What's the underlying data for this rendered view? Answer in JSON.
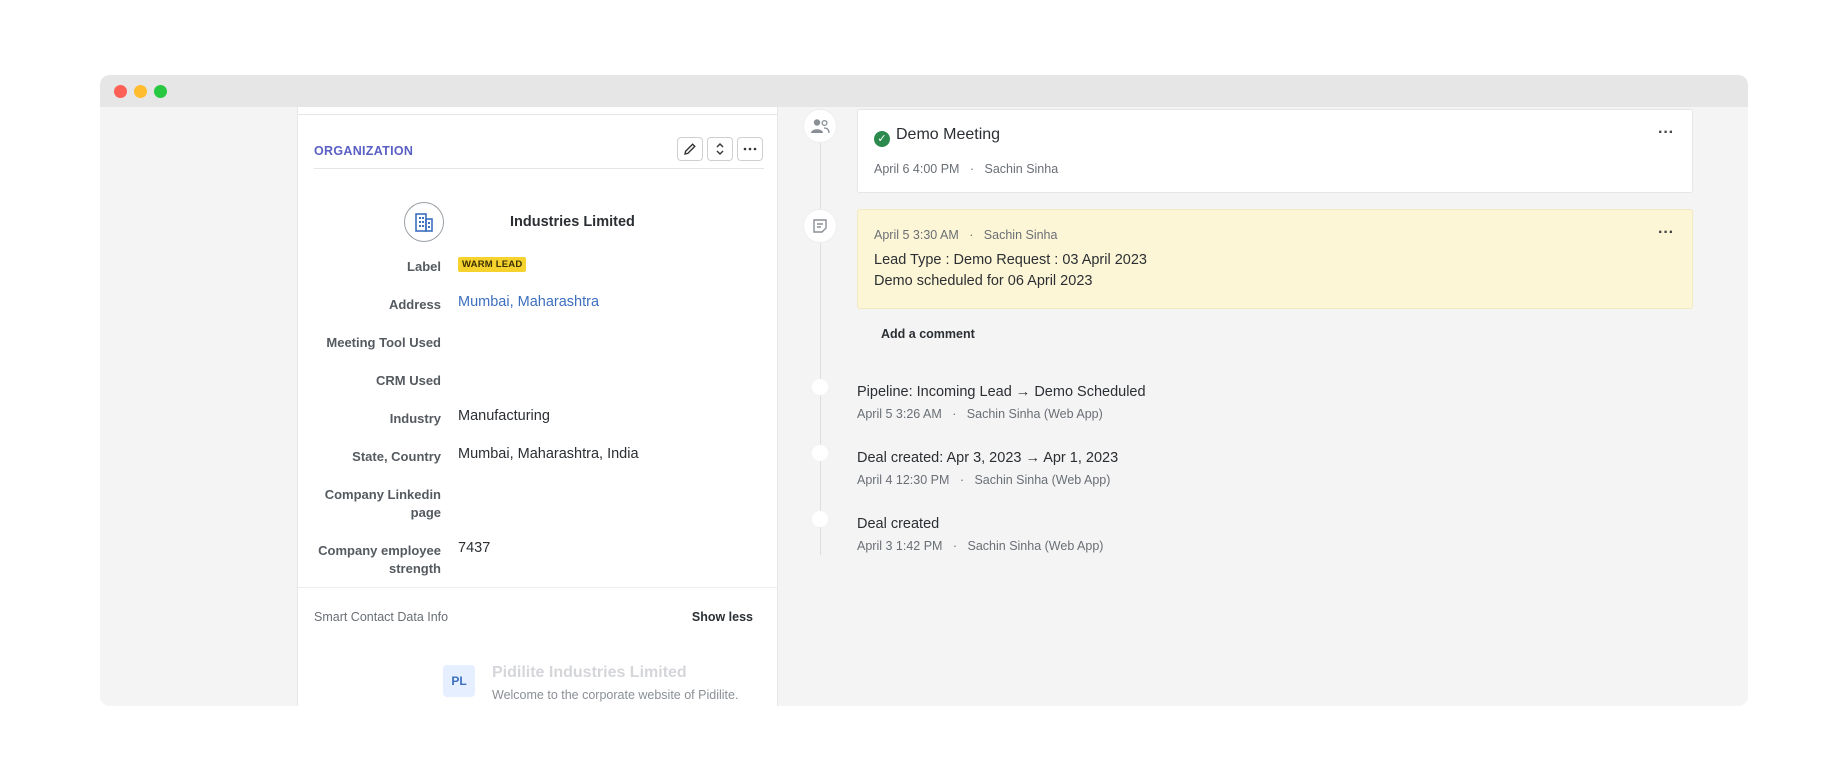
{
  "window": {
    "controls": [
      "close",
      "minimize",
      "maximize"
    ]
  },
  "organization": {
    "section_title": "ORGANIZATION",
    "actions": [
      "edit-icon",
      "expand-collapse-icon",
      "more-icon"
    ],
    "name": "Industries Limited",
    "fields": [
      {
        "label": "Label",
        "value": "WARM LEAD",
        "type": "badge"
      },
      {
        "label": "Address",
        "value": "Mumbai, Maharashtra",
        "type": "link"
      },
      {
        "label": "Meeting Tool Used",
        "value": ""
      },
      {
        "label": "CRM Used",
        "value": ""
      },
      {
        "label": "Industry",
        "value": "Manufacturing"
      },
      {
        "label": "State, Country",
        "value": "Mumbai, Maharashtra, India"
      },
      {
        "label": "Company Linkedin page",
        "value": ""
      },
      {
        "label": "Company employee strength",
        "value": "7437"
      }
    ],
    "smart_data_label": "Smart Contact Data Info",
    "show_less_label": "Show less",
    "suggestion": {
      "avatar": "PL",
      "name": "Pidilite Industries Limited",
      "description": "Welcome to the corporate website of Pidilite."
    }
  },
  "timeline": {
    "meeting": {
      "title": "Demo Meeting",
      "meta": "April 6 4:00 PM",
      "author": "Sachin Sinha"
    },
    "note": {
      "meta": "April 5 3:30 AM",
      "author": "Sachin Sinha",
      "line1": "Lead Type : Demo Request : 03 April 2023",
      "line2": "Demo scheduled for 06 April 2023"
    },
    "add_comment_label": "Add a comment",
    "events": [
      {
        "title": "Pipeline: Incoming Lead → Demo Scheduled",
        "time": "April 5 3:26 AM",
        "author": "Sachin Sinha (Web App)"
      },
      {
        "title": "Deal created: Apr 3, 2023 → Apr 1, 2023",
        "time": "April 4 12:30 PM",
        "author": "Sachin Sinha (Web App)"
      },
      {
        "title": "Deal created",
        "time": "April 3 1:42 PM",
        "author": "Sachin Sinha (Web App)"
      }
    ]
  },
  "colors": {
    "accent": "#5a5fc4",
    "badge": "#f5d22e",
    "link": "#3d6fbf",
    "note_bg": "#fdf6d6",
    "success": "#2d8a4e"
  }
}
